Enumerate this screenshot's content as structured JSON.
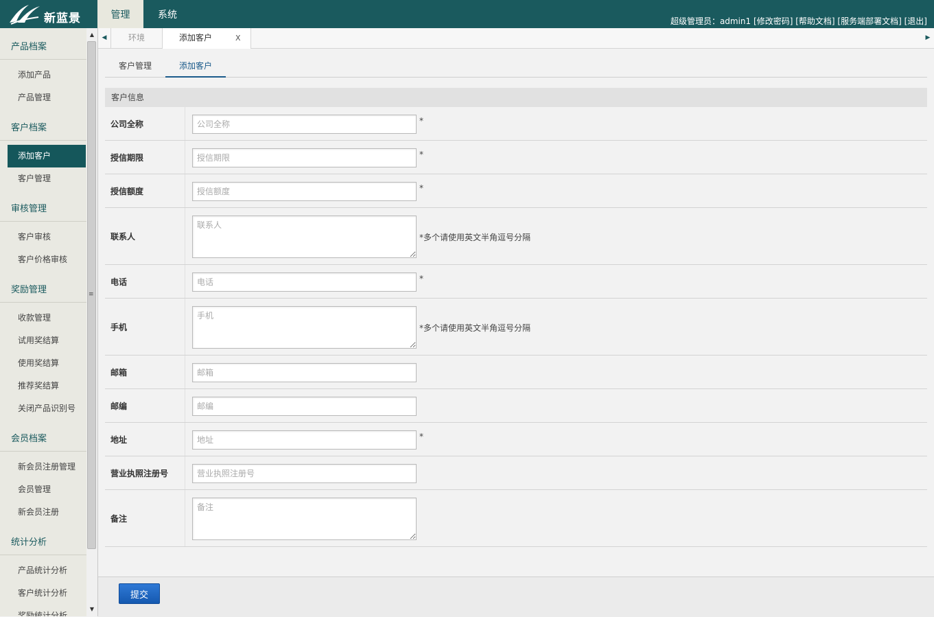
{
  "app": {
    "logo_text": "新蓝景",
    "top_tabs": [
      "管理",
      "系统"
    ],
    "user": {
      "role_label": "超级管理员：admin1",
      "links": [
        "[修改密码]",
        "[帮助文档]",
        "[服务端部署文档]",
        "[退出]"
      ]
    }
  },
  "sidebar": {
    "groups": [
      {
        "title": "产品档案",
        "items": [
          "添加产品",
          "产品管理"
        ]
      },
      {
        "title": "客户档案",
        "items": [
          "添加客户",
          "客户管理"
        ]
      },
      {
        "title": "审核管理",
        "items": [
          "客户审核",
          "客户价格审核"
        ]
      },
      {
        "title": "奖励管理",
        "items": [
          "收款管理",
          "试用奖结算",
          "使用奖结算",
          "推荐奖结算",
          "关闭产品识别号"
        ]
      },
      {
        "title": "会员档案",
        "items": [
          "新会员注册管理",
          "会员管理",
          "新会员注册"
        ]
      },
      {
        "title": "统计分析",
        "items": [
          "产品统计分析",
          "客户统计分析",
          "奖励统计分析"
        ]
      }
    ],
    "active_item": "添加客户"
  },
  "page_tabs": {
    "tabs": [
      {
        "label": "环境"
      },
      {
        "label": "添加客户",
        "close": "X"
      }
    ]
  },
  "sub_tabs": [
    "客户管理",
    "添加客户"
  ],
  "form": {
    "section_title": "客户信息",
    "fields": [
      {
        "label": "公司全称",
        "placeholder": "公司全称",
        "type": "input",
        "note": "*"
      },
      {
        "label": "授信期限",
        "placeholder": "授信期限",
        "type": "input",
        "note": "*"
      },
      {
        "label": "授信额度",
        "placeholder": "授信额度",
        "type": "input",
        "note": "*"
      },
      {
        "label": "联系人",
        "placeholder": "联系人",
        "type": "textarea",
        "note": "*多个请使用英文半角逗号分隔"
      },
      {
        "label": "电话",
        "placeholder": "电话",
        "type": "input",
        "note": "*"
      },
      {
        "label": "手机",
        "placeholder": "手机",
        "type": "textarea",
        "note": "*多个请使用英文半角逗号分隔"
      },
      {
        "label": "邮箱",
        "placeholder": "邮箱",
        "type": "input",
        "note": ""
      },
      {
        "label": "邮编",
        "placeholder": "邮编",
        "type": "input",
        "note": ""
      },
      {
        "label": "地址",
        "placeholder": "地址",
        "type": "input",
        "note": "*"
      },
      {
        "label": "营业执照注册号",
        "placeholder": "营业执照注册号",
        "type": "input",
        "note": ""
      },
      {
        "label": "备注",
        "placeholder": "备注",
        "type": "textarea",
        "note": ""
      }
    ],
    "submit_label": "提交"
  },
  "colors": {
    "brand": "#1a5a5e",
    "submit": "#1f68c2",
    "link_active": "#1a5a8a"
  }
}
